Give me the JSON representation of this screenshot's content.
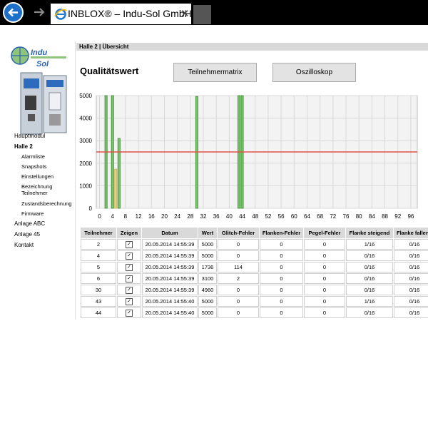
{
  "browser": {
    "tab_title": "INBLOX® – Indu-Sol GmbH",
    "tab_close": "✕"
  },
  "logo": {
    "text_top": "Indu",
    "text_bottom": "Sol"
  },
  "sidebar": {
    "items": [
      {
        "label": "Hauptmodul",
        "level": 1,
        "bold": false
      },
      {
        "label": "Halle 2",
        "level": 1,
        "bold": true
      },
      {
        "label": "Alarmliste",
        "level": 2
      },
      {
        "label": "Snapshots",
        "level": 2
      },
      {
        "label": "Einstellungen",
        "level": 2
      },
      {
        "label": "Bezeichnung",
        "level": 2
      },
      {
        "label": "Teilnehmer",
        "level": 2
      },
      {
        "label": "Zustandsberechnung",
        "level": 2
      },
      {
        "label": "Firmware",
        "level": 2
      },
      {
        "label": "Anlage ABC",
        "level": 1
      },
      {
        "label": "Anlage 45",
        "level": 1
      },
      {
        "label": "Kontakt",
        "level": 1
      }
    ]
  },
  "breadcrumb": "Halle 2 | Übersicht",
  "page_title": "Qualitätswert",
  "buttons": {
    "teilnehmermatrix": "Teilnehmermatrix",
    "oszilloskop": "Oszilloskop"
  },
  "chart_data": {
    "type": "bar",
    "x_ticks": [
      0,
      4,
      8,
      12,
      16,
      20,
      24,
      28,
      32,
      36,
      40,
      44,
      48,
      52,
      56,
      60,
      64,
      68,
      72,
      76,
      80,
      84,
      88,
      92,
      96
    ],
    "x_tick_labels": [
      "0",
      "4",
      "8",
      "12",
      "16",
      "20",
      "24",
      "28",
      "32",
      "36",
      "40",
      "44",
      "48",
      "52",
      "56",
      "60",
      "64",
      "68",
      "72",
      "76",
      "80",
      "84",
      "88",
      "92",
      "96"
    ],
    "y_ticks": [
      0,
      1000,
      2000,
      3000,
      4000,
      5000
    ],
    "y_tick_labels": [
      "0",
      "1000",
      "2000",
      "3000",
      "4000",
      "5000"
    ],
    "xlim": [
      -1,
      98
    ],
    "ylim": [
      0,
      5000
    ],
    "threshold": 2500,
    "bars": [
      {
        "x": 2,
        "value": 5000,
        "status": "good"
      },
      {
        "x": 4,
        "value": 5000,
        "status": "good"
      },
      {
        "x": 5,
        "value": 1736,
        "status": "warning"
      },
      {
        "x": 6,
        "value": 3100,
        "status": "good"
      },
      {
        "x": 30,
        "value": 4960,
        "status": "good"
      },
      {
        "x": 43,
        "value": 5000,
        "status": "good"
      },
      {
        "x": 44,
        "value": 5000,
        "status": "good"
      }
    ],
    "colors": {
      "good": "#7cc16e",
      "good_border": "#3a8a32",
      "warning": "#e6d272",
      "threshold": "#e0534a",
      "grid": "#d8d8d8"
    }
  },
  "table": {
    "headers": [
      "Teilnehmer",
      "Zeigen",
      "Datum",
      "Wert",
      "Glitch-Fehler",
      "Flanken-Fehler",
      "Pegel-Fehler",
      "Flanke steigend",
      "Flanke fallend"
    ],
    "rows": [
      [
        "2",
        "✓",
        "20.05.2014 14:55:39",
        "5000",
        "0",
        "0",
        "0",
        "1/16",
        "0/16"
      ],
      [
        "4",
        "✓",
        "20.05.2014 14:55:39",
        "5000",
        "0",
        "0",
        "0",
        "0/16",
        "0/16"
      ],
      [
        "5",
        "✓",
        "20.05.2014 14:55:39",
        "1736",
        "114",
        "0",
        "0",
        "0/16",
        "0/16"
      ],
      [
        "6",
        "✓",
        "20.05.2014 14:55:39",
        "3100",
        "2",
        "0",
        "0",
        "0/16",
        "0/16"
      ],
      [
        "30",
        "✓",
        "20.05.2014 14:55:39",
        "4960",
        "0",
        "0",
        "0",
        "0/16",
        "0/16"
      ],
      [
        "43",
        "✓",
        "20.05.2014 14:55:40",
        "5000",
        "0",
        "0",
        "0",
        "1/16",
        "0/16"
      ],
      [
        "44",
        "✓",
        "20.05.2014 14:55:40",
        "5000",
        "0",
        "0",
        "0",
        "0/16",
        "0/16"
      ]
    ]
  }
}
